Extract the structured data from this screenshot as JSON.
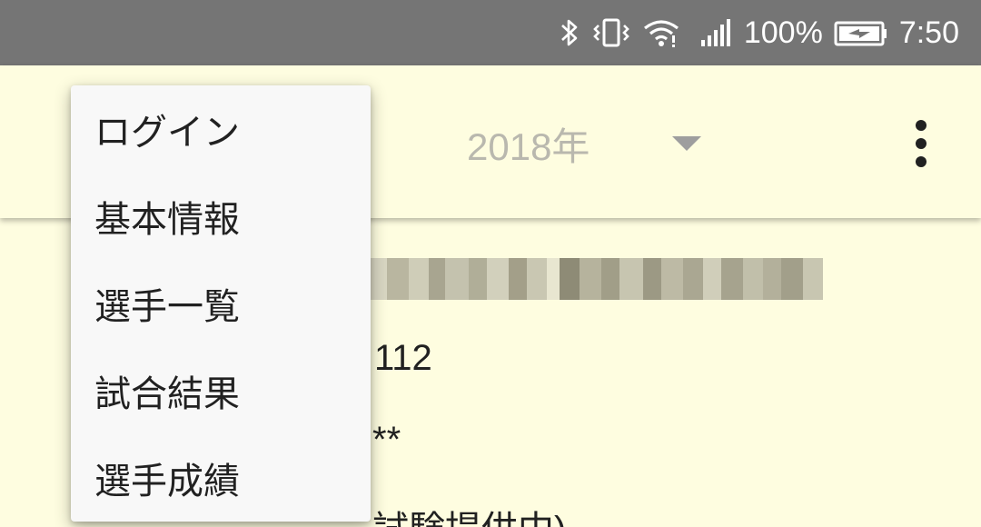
{
  "status_bar": {
    "battery_percent": "100%",
    "time": "7:50",
    "icons": [
      "bluetooth-icon",
      "vibrate-icon",
      "wifi-icon",
      "cell-signal-icon",
      "battery-charging-icon"
    ]
  },
  "app_bar": {
    "year_selected": "2018年"
  },
  "menu": {
    "items": [
      {
        "label": "ログイン"
      },
      {
        "label": "基本情報"
      },
      {
        "label": "選手一覧"
      },
      {
        "label": "試合結果"
      },
      {
        "label": "選手成績"
      }
    ]
  },
  "content": {
    "line_2": "112",
    "line_3": "**",
    "line_4": "試験提供中)"
  },
  "colors": {
    "status_bar_bg": "#757575",
    "background": "#fefde0",
    "menu_bg": "#f8f8f8",
    "text": "#212121",
    "muted_text": "#b9b8ae"
  }
}
